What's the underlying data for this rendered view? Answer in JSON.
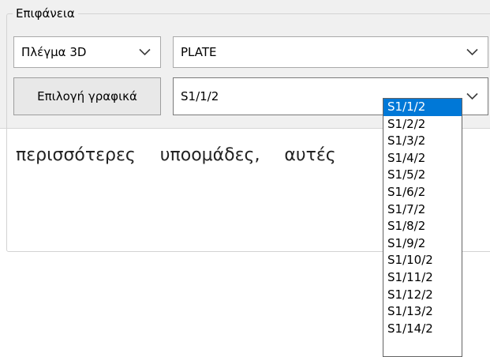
{
  "group": {
    "title": "Επιφάνεια"
  },
  "mesh_combo": {
    "value": "Πλέγμα 3D",
    "icon": "chevron-down-icon"
  },
  "element_combo": {
    "value": "PLATE",
    "icon": "chevron-down-icon"
  },
  "select_button": {
    "label": "Επιλογή γραφικά"
  },
  "subgroup_combo": {
    "value": "S1/1/2",
    "icon": "chevron-down-icon",
    "expanded": true
  },
  "dropdown": {
    "selected_index": 0,
    "options": [
      "S1/1/2",
      "S1/2/2",
      "S1/3/2",
      "S1/4/2",
      "S1/5/2",
      "S1/6/2",
      "S1/7/2",
      "S1/8/2",
      "S1/9/2",
      "S1/10/2",
      "S1/11/2",
      "S1/12/2",
      "S1/13/2",
      "S1/14/2"
    ]
  },
  "document": {
    "text": "περισσότερες υποομάδες, αυτές"
  },
  "colors": {
    "panel_bg": "#f0f0f0",
    "selection_bg": "#0078d7",
    "selection_fg": "#ffffff",
    "border": "#a9a9a9"
  }
}
